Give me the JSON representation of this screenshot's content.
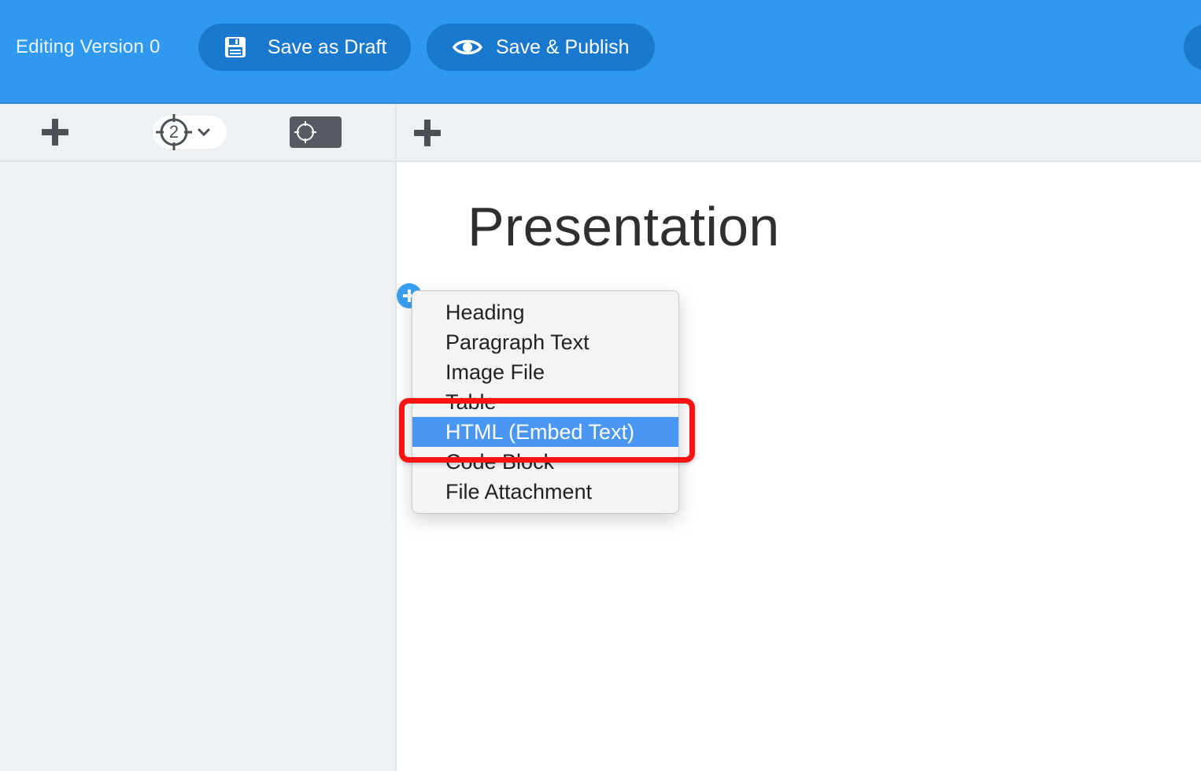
{
  "header": {
    "version_label": "Editing Version 0",
    "save_draft_label": "Save as Draft",
    "save_publish_label": "Save & Publish",
    "accent_color": "#2f99ef"
  },
  "toolbar": {
    "left_add_icon": "plus-icon",
    "level_value": "2",
    "level_icon": "crosshair-icon",
    "focus_icon": "crosshair-icon",
    "right_add_icon": "plus-icon"
  },
  "document": {
    "title": "Presentation"
  },
  "block_menu": {
    "items": [
      {
        "label": "Heading"
      },
      {
        "label": "Paragraph Text"
      },
      {
        "label": "Image File"
      },
      {
        "label": "Table"
      },
      {
        "label": "HTML (Embed Text)"
      },
      {
        "label": "Code Block"
      },
      {
        "label": "File Attachment"
      }
    ],
    "selected": "HTML (Embed Text)",
    "highlight_color": "#ff1212"
  }
}
